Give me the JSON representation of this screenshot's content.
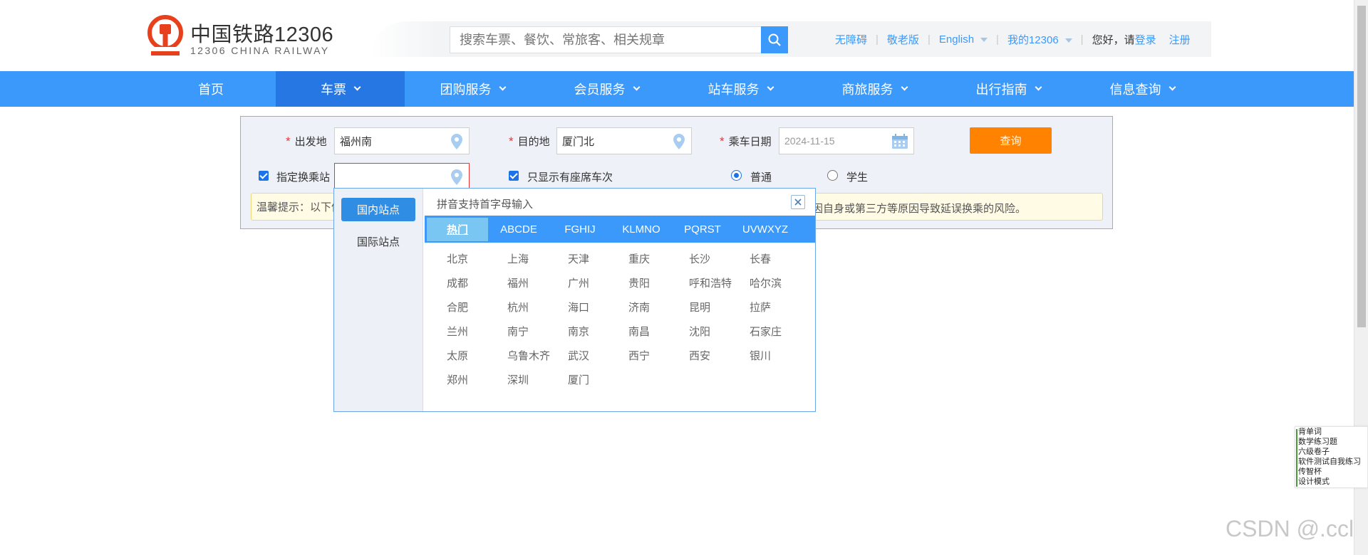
{
  "header": {
    "logo_title": "中国铁路12306",
    "logo_subtitle": "12306 CHINA RAILWAY",
    "search_placeholder": "搜索车票、餐饮、常旅客、相关规章",
    "links": {
      "accessible": "无障碍",
      "elderly": "敬老版",
      "english": "English",
      "my12306": "我的12306",
      "greeting": "您好，请",
      "login": "登录",
      "register": "注册"
    }
  },
  "nav": {
    "items": [
      "首页",
      "车票",
      "团购服务",
      "会员服务",
      "站车服务",
      "商旅服务",
      "出行指南",
      "信息查询"
    ],
    "active": "车票"
  },
  "query": {
    "from_label": "出发地",
    "from_value": "福州南",
    "to_label": "目的地",
    "to_value": "厦门北",
    "date_label": "乘车日期",
    "date_value": "2024-11-15",
    "query_button": "查询",
    "transfer_label": "指定换乘站",
    "transfer_value": "",
    "seats_only_label": "只显示有座席车次",
    "normal_label": "普通",
    "student_label": "学生",
    "tip_left": "温馨提示：以下信",
    "tip_right": "因自身或第三方等原因导致延误换乘的风险。"
  },
  "popup": {
    "tabs": [
      "国内站点",
      "国际站点"
    ],
    "hint": "拼音支持首字母输入",
    "letters": [
      "热门",
      "ABCDE",
      "FGHIJ",
      "KLMNO",
      "PQRST",
      "UVWXYZ"
    ],
    "cities": [
      "北京",
      "上海",
      "天津",
      "重庆",
      "长沙",
      "长春",
      "成都",
      "福州",
      "广州",
      "贵阳",
      "呼和浩特",
      "哈尔滨",
      "合肥",
      "杭州",
      "海口",
      "济南",
      "昆明",
      "拉萨",
      "兰州",
      "南宁",
      "南京",
      "南昌",
      "沈阳",
      "石家庄",
      "太原",
      "乌鲁木齐",
      "武汉",
      "西宁",
      "西安",
      "银川",
      "郑州",
      "深圳",
      "厦门"
    ]
  },
  "side_menu": [
    "背单词",
    "数学练习题",
    "六级卷子",
    "软件测试自我练习",
    "传智杯",
    "设计模式"
  ],
  "watermark": "CSDN @.ccl",
  "colors": {
    "primary": "#3b99fc",
    "nav_active": "#2676e3",
    "query_button": "#ff8200",
    "logo_red": "#e8401c"
  }
}
